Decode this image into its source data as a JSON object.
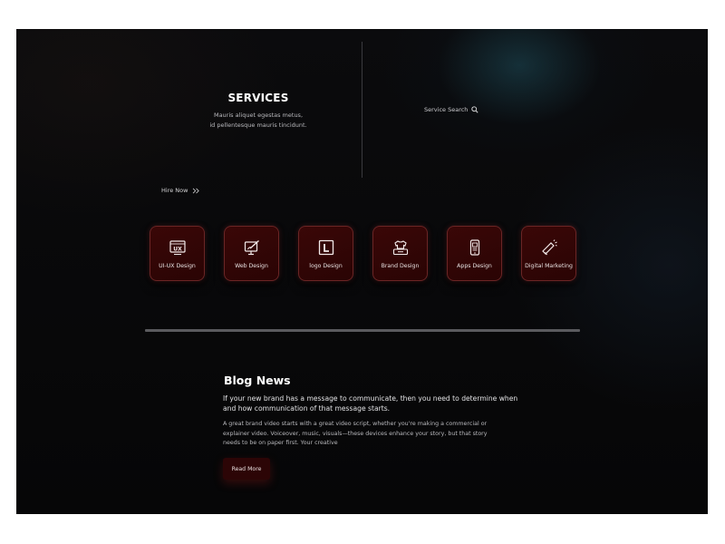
{
  "services": {
    "title": "SERVICES",
    "subtitle_line1": "Mauris aliquet egestas metus,",
    "subtitle_line2": "id pellentesque mauris tincidunt."
  },
  "search": {
    "label": "Service Search",
    "icon": "search-icon"
  },
  "hire": {
    "label": "Hire Now",
    "icon": "double-chevron-right-icon"
  },
  "service_cards": [
    {
      "label": "UI-UX Design",
      "icon": "ux-screen-icon"
    },
    {
      "label": "Web Design",
      "icon": "monitor-pen-icon"
    },
    {
      "label": "logo Design",
      "icon": "logo-letter-icon"
    },
    {
      "label": "Brand Design",
      "icon": "tshirt-box-icon"
    },
    {
      "label": "Apps Design",
      "icon": "mobile-app-icon"
    },
    {
      "label": "Digital Marketing",
      "icon": "megaphone-icon"
    }
  ],
  "blog": {
    "title": "Blog News",
    "lead": "If your new brand has a message to communicate, then you need to determine when and how communication of that message starts.",
    "body": "A great brand video starts with a great video script, whether you're making a commercial or explainer video. Voiceover, music, visuals—these devices enhance your story, but that story needs to be on paper first. Your creative",
    "button_label": "Read More"
  },
  "colors": {
    "background": "#0a0a0c",
    "card_bg": "#3a0707",
    "card_border": "#6a2525",
    "button_bg": "#2c0506"
  }
}
